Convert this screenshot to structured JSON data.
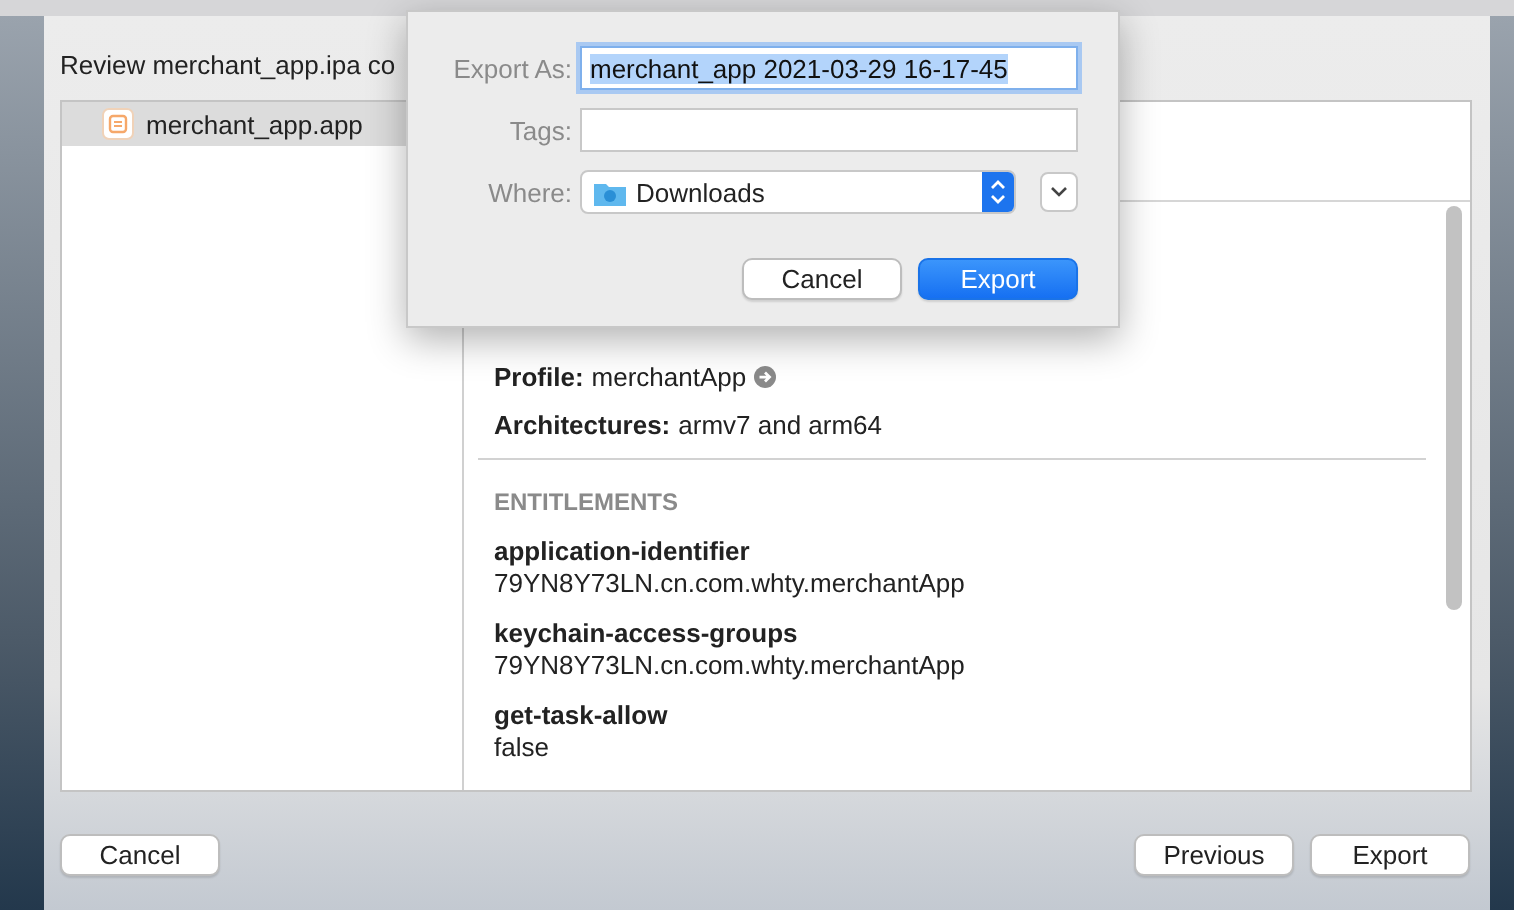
{
  "sheet": {
    "heading": "Review merchant_app.ipa co",
    "items": [
      {
        "label": "merchant_app.app",
        "selected": true
      }
    ],
    "details": [
      {
        "kind": "link",
        "label": "Profile:",
        "value": "merchantApp"
      },
      {
        "kind": "plain",
        "label": "Architectures:",
        "value": "armv7 and arm64"
      }
    ],
    "section": "ENTITLEMENTS",
    "entitlements": [
      {
        "key": "application-identifier",
        "value": "79YN8Y73LN.cn.com.whty.merchantApp"
      },
      {
        "key": "keychain-access-groups",
        "value": "79YN8Y73LN.cn.com.whty.merchantApp"
      },
      {
        "key": "get-task-allow",
        "value": "false"
      }
    ],
    "buttons": [
      {
        "label": "Cancel"
      },
      {
        "label": "Previous"
      },
      {
        "label": "Export"
      }
    ]
  },
  "save_dialog": {
    "export_as": {
      "label": "Export As:",
      "value": "merchant_app 2021-03-29 16-17-45"
    },
    "tags": {
      "label": "Tags:"
    },
    "where": {
      "label": "Where:",
      "value": "Downloads"
    },
    "buttons": [
      {
        "label": "Cancel",
        "primary": false
      },
      {
        "label": "Export",
        "primary": true
      }
    ]
  }
}
